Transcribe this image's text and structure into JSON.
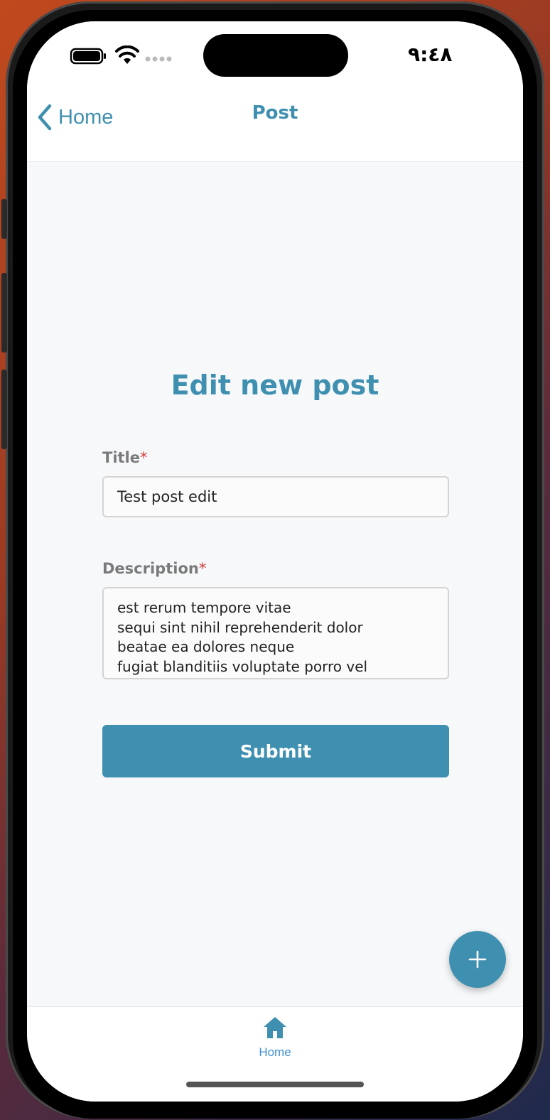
{
  "status_bar": {
    "time": "٩:٤٨"
  },
  "nav": {
    "back_label": "Home",
    "title": "Post"
  },
  "form": {
    "heading": "Edit new post",
    "title_label": "Title",
    "title_value": "Test post edit",
    "description_label": "Description",
    "description_value": "est rerum tempore vitae\nsequi sint nihil reprehenderit dolor\nbeatae ea dolores neque\nfugiat blanditiis voluptate porro vel",
    "required_mark": "*",
    "submit_label": "Submit"
  },
  "fab": {
    "icon": "plus-icon"
  },
  "tab_bar": {
    "items": [
      {
        "label": "Home",
        "icon": "home-icon",
        "active": true
      }
    ]
  },
  "colors": {
    "accent": "#3f90b0",
    "tab_active": "#3f90d4",
    "required": "#d33a3a",
    "label_gray": "#7a7a7a",
    "background": "#f7f8fa"
  }
}
